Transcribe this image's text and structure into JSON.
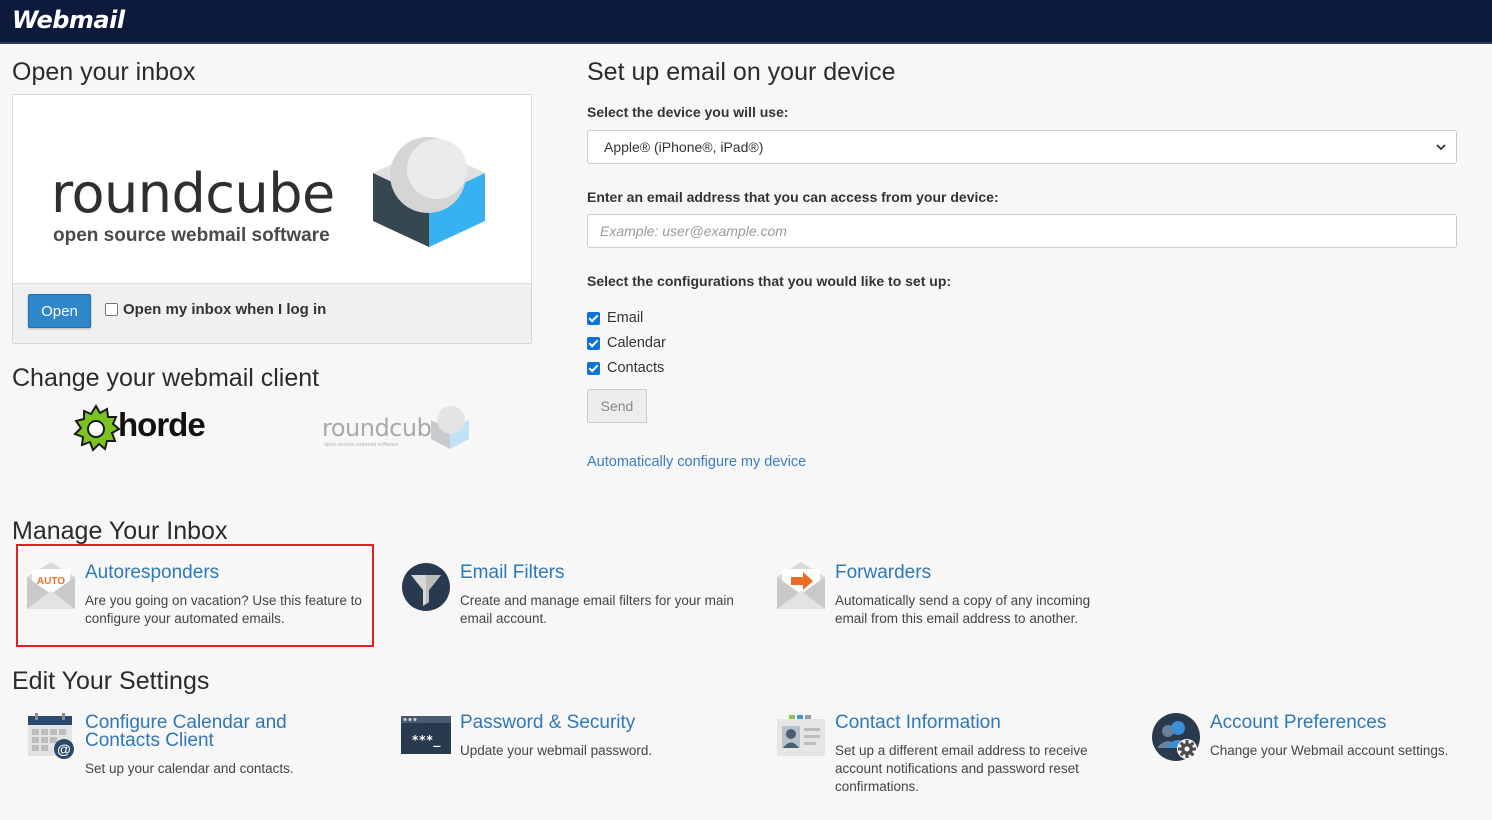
{
  "header": {
    "brand": "Webmail"
  },
  "inbox": {
    "heading": "Open your inbox",
    "logo_word": "roundcube",
    "logo_sub": "open source webmail software",
    "open_button": "Open",
    "open_on_login_label": "Open my inbox when I log in"
  },
  "change_client": {
    "heading": "Change your webmail client",
    "clients": [
      {
        "name": "horde"
      },
      {
        "name": "roundcube",
        "sub": "open source webmail software"
      }
    ]
  },
  "setup": {
    "heading": "Set up email on your device",
    "device_label": "Select the device you will use:",
    "device_value": "Apple® (iPhone®, iPad®)",
    "email_label": "Enter an email address that you can access from your device:",
    "email_placeholder": "Example: user@example.com",
    "config_label": "Select the configurations that you would like to set up:",
    "configs": [
      {
        "label": "Email",
        "checked": true
      },
      {
        "label": "Calendar",
        "checked": true
      },
      {
        "label": "Contacts",
        "checked": true
      }
    ],
    "send_button": "Send",
    "auto_link": "Automatically configure my device"
  },
  "manage": {
    "heading": "Manage Your Inbox",
    "items": [
      {
        "title": "Autoresponders",
        "desc": "Are you going on vacation? Use this feature to configure your automated emails.",
        "icon": "autoresponder-icon",
        "badge": "AUTO"
      },
      {
        "title": "Email Filters",
        "desc": "Create and manage email filters for your main email account.",
        "icon": "filter-icon"
      },
      {
        "title": "Forwarders",
        "desc": "Automatically send a copy of any incoming email from this email address to another.",
        "icon": "forwarder-icon"
      }
    ]
  },
  "settings": {
    "heading": "Edit Your Settings",
    "items": [
      {
        "title": "Configure Calendar and Contacts Client",
        "desc": "Set up your calendar and contacts.",
        "icon": "calendar-icon"
      },
      {
        "title": "Password & Security",
        "desc": "Update your webmail password.",
        "icon": "password-icon",
        "badge": "***_"
      },
      {
        "title": "Contact Information",
        "desc": "Set up a different email address to receive account notifications and password reset confirmations.",
        "icon": "contact-card-icon"
      },
      {
        "title": "Account Preferences",
        "desc": "Change your Webmail account settings.",
        "icon": "user-settings-icon"
      }
    ]
  },
  "colors": {
    "header_bg": "#0e1a3c",
    "link": "#2e78b8",
    "primary_button": "#2e86cb",
    "highlight": "#e02020"
  }
}
